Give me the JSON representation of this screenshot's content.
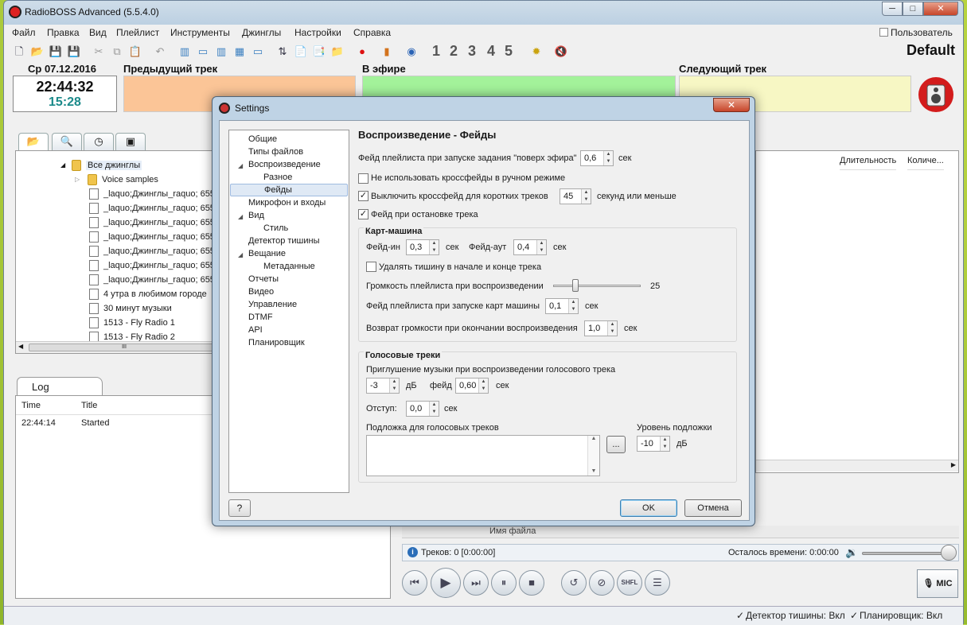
{
  "app": {
    "title": "RadioBOSS Advanced (5.5.4.0)",
    "window_controls": [
      "─",
      "□",
      "✕"
    ]
  },
  "menu": [
    "Файл",
    "Правка",
    "Вид",
    "Плейлист",
    "Инструменты",
    "Джинглы",
    "Настройки",
    "Справка"
  ],
  "user_menu": "Пользователь",
  "toolbar_numbers": [
    "1",
    "2",
    "3",
    "4",
    "5"
  ],
  "profile": "Default",
  "clock": {
    "date": "Ср 07.12.2016",
    "time": "22:44:32",
    "elapsed": "15:28"
  },
  "now_playing": {
    "prev_label": "Предыдущий трек",
    "onair_label": "В эфире",
    "next_label": "Следующий трек"
  },
  "tree": {
    "items": [
      "Все джинглы",
      "Voice samples",
      "_laquo;Джинглы_raquo; 655",
      "_laquo;Джинглы_raquo; 655",
      "_laquo;Джинглы_raquo; 655",
      "_laquo;Джинглы_raquo; 655",
      "_laquo;Джинглы_raquo; 655",
      "_laquo;Джинглы_raquo; 655",
      "_laquo;Джинглы_raquo; 655",
      "4 утра в любимом городе",
      "30 минут музыки",
      "1513 - Fly Radio 1",
      "1513 - Fly Radio 2"
    ],
    "scroll_grip": "III"
  },
  "log": {
    "tab": "Log",
    "columns": [
      "Time",
      "Title"
    ],
    "rows": [
      {
        "time": "22:44:14",
        "title": "Started"
      }
    ]
  },
  "playlist": {
    "columns": [
      "Длительность",
      "Количе..."
    ],
    "filename_header": "Имя файла",
    "tracks_info": "Треков: 0 [0:00:00]",
    "remaining": "Осталось времени: 0:00:00",
    "mic_label": "MIC",
    "shfl_label": "SHFL"
  },
  "statusbar": {
    "silence": "Детектор тишины: Вкл",
    "scheduler": "Планировщик: Вкл"
  },
  "settings": {
    "title": "Settings",
    "nav": [
      {
        "label": "Общие",
        "level": 0,
        "arrow": ""
      },
      {
        "label": "Типы файлов",
        "level": 0,
        "arrow": ""
      },
      {
        "label": "Воспроизведение",
        "level": 0,
        "arrow": "◢"
      },
      {
        "label": "Разное",
        "level": 1,
        "arrow": ""
      },
      {
        "label": "Фейды",
        "level": 1,
        "arrow": "",
        "selected": true
      },
      {
        "label": "Микрофон и входы",
        "level": 0,
        "arrow": ""
      },
      {
        "label": "Вид",
        "level": 0,
        "arrow": "◢"
      },
      {
        "label": "Стиль",
        "level": 1,
        "arrow": ""
      },
      {
        "label": "Детектор тишины",
        "level": 0,
        "arrow": ""
      },
      {
        "label": "Вещание",
        "level": 0,
        "arrow": "◢"
      },
      {
        "label": "Метаданные",
        "level": 1,
        "arrow": ""
      },
      {
        "label": "Отчеты",
        "level": 0,
        "arrow": ""
      },
      {
        "label": "Видео",
        "level": 0,
        "arrow": ""
      },
      {
        "label": "Управление",
        "level": 0,
        "arrow": ""
      },
      {
        "label": "DTMF",
        "level": 0,
        "arrow": ""
      },
      {
        "label": "API",
        "level": 0,
        "arrow": ""
      },
      {
        "label": "Планировщик",
        "level": 0,
        "arrow": ""
      }
    ],
    "page_title": "Воспроизведение - Фейды",
    "fade_on_top_label": "Фейд плейлиста при запуске задания \"поверх эфира\"",
    "fade_on_top_value": "0,6",
    "unit_sec": "сек",
    "no_crossfade_manual": "Не использовать кроссфейды в ручном режиме",
    "no_crossfade_manual_checked": false,
    "disable_crossfade_short": "Выключить кроссфейд для коротких треков",
    "disable_crossfade_short_checked": true,
    "short_track_seconds": "45",
    "seconds_or_less": "секунд или меньше",
    "fade_on_stop": "Фейд при остановке трека",
    "fade_on_stop_checked": true,
    "cart": {
      "title": "Карт-машина",
      "fade_in_label": "Фейд-ин",
      "fade_in_value": "0,3",
      "fade_out_label": "Фейд-аут",
      "fade_out_value": "0,4",
      "remove_silence": "Удалять тишину в начале и конце трека",
      "remove_silence_checked": false,
      "playlist_volume_label": "Громкость плейлиста при воспроизведении",
      "playlist_volume_value": "25",
      "playlist_volume_fraction": 0.25,
      "playlist_fade_label": "Фейд плейлиста при запуске карт машины",
      "playlist_fade_value": "0,1",
      "restore_volume_label": "Возврат громкости при окончании воспроизведения",
      "restore_volume_value": "1,0"
    },
    "voice": {
      "title": "Голосовые треки",
      "ducking_label": "Приглушение музыки при воспроизведении голосового трека",
      "ducking_value": "-3",
      "unit_db": "дБ",
      "fade_label": "фейд",
      "fade_value": "0,60",
      "offset_label": "Отступ:",
      "offset_value": "0,0",
      "bed_label": "Подложка для голосовых треков",
      "browse": "...",
      "bed_level_label": "Уровень подложки",
      "bed_level_value": "-10"
    },
    "ok": "OK",
    "cancel": "Отмена",
    "help": "?"
  }
}
